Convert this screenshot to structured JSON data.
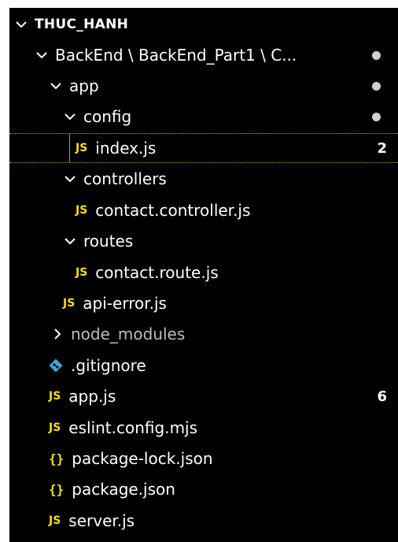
{
  "explorer": {
    "root": {
      "label": "THUC_HANH"
    },
    "items": [
      {
        "label": "BackEnd \\ BackEnd_Part1 \\ C...",
        "type": "folder",
        "expanded": true,
        "badge": "dot"
      },
      {
        "label": "app",
        "type": "folder",
        "expanded": true,
        "badge": "dot"
      },
      {
        "label": "config",
        "type": "folder",
        "expanded": true,
        "badge": "dot"
      },
      {
        "label": "index.js",
        "type": "js",
        "icon": "JS",
        "count": "2",
        "selected": true
      },
      {
        "label": "controllers",
        "type": "folder",
        "expanded": true
      },
      {
        "label": "contact.controller.js",
        "type": "js",
        "icon": "JS"
      },
      {
        "label": "routes",
        "type": "folder",
        "expanded": true
      },
      {
        "label": "contact.route.js",
        "type": "js",
        "icon": "JS"
      },
      {
        "label": "api-error.js",
        "type": "js",
        "icon": "JS"
      },
      {
        "label": "node_modules",
        "type": "folder",
        "expanded": false,
        "muted": true
      },
      {
        "label": ".gitignore",
        "type": "git"
      },
      {
        "label": "app.js",
        "type": "js",
        "icon": "JS",
        "count": "6"
      },
      {
        "label": "eslint.config.mjs",
        "type": "js",
        "icon": "JS"
      },
      {
        "label": "package-lock.json",
        "type": "json",
        "icon": "{}"
      },
      {
        "label": "package.json",
        "type": "json",
        "icon": "{}"
      },
      {
        "label": "server.js",
        "type": "js",
        "icon": "JS"
      }
    ]
  },
  "colors": {
    "background": "#000000",
    "text": "#ffffff",
    "js_icon": "#f5de19",
    "json_icon": "#f5de19",
    "git_icon": "#41a6d9",
    "modified_dot": "#d0d0d0",
    "muted_text": "#bdbdbd",
    "selection_border": "#c8a45a"
  }
}
